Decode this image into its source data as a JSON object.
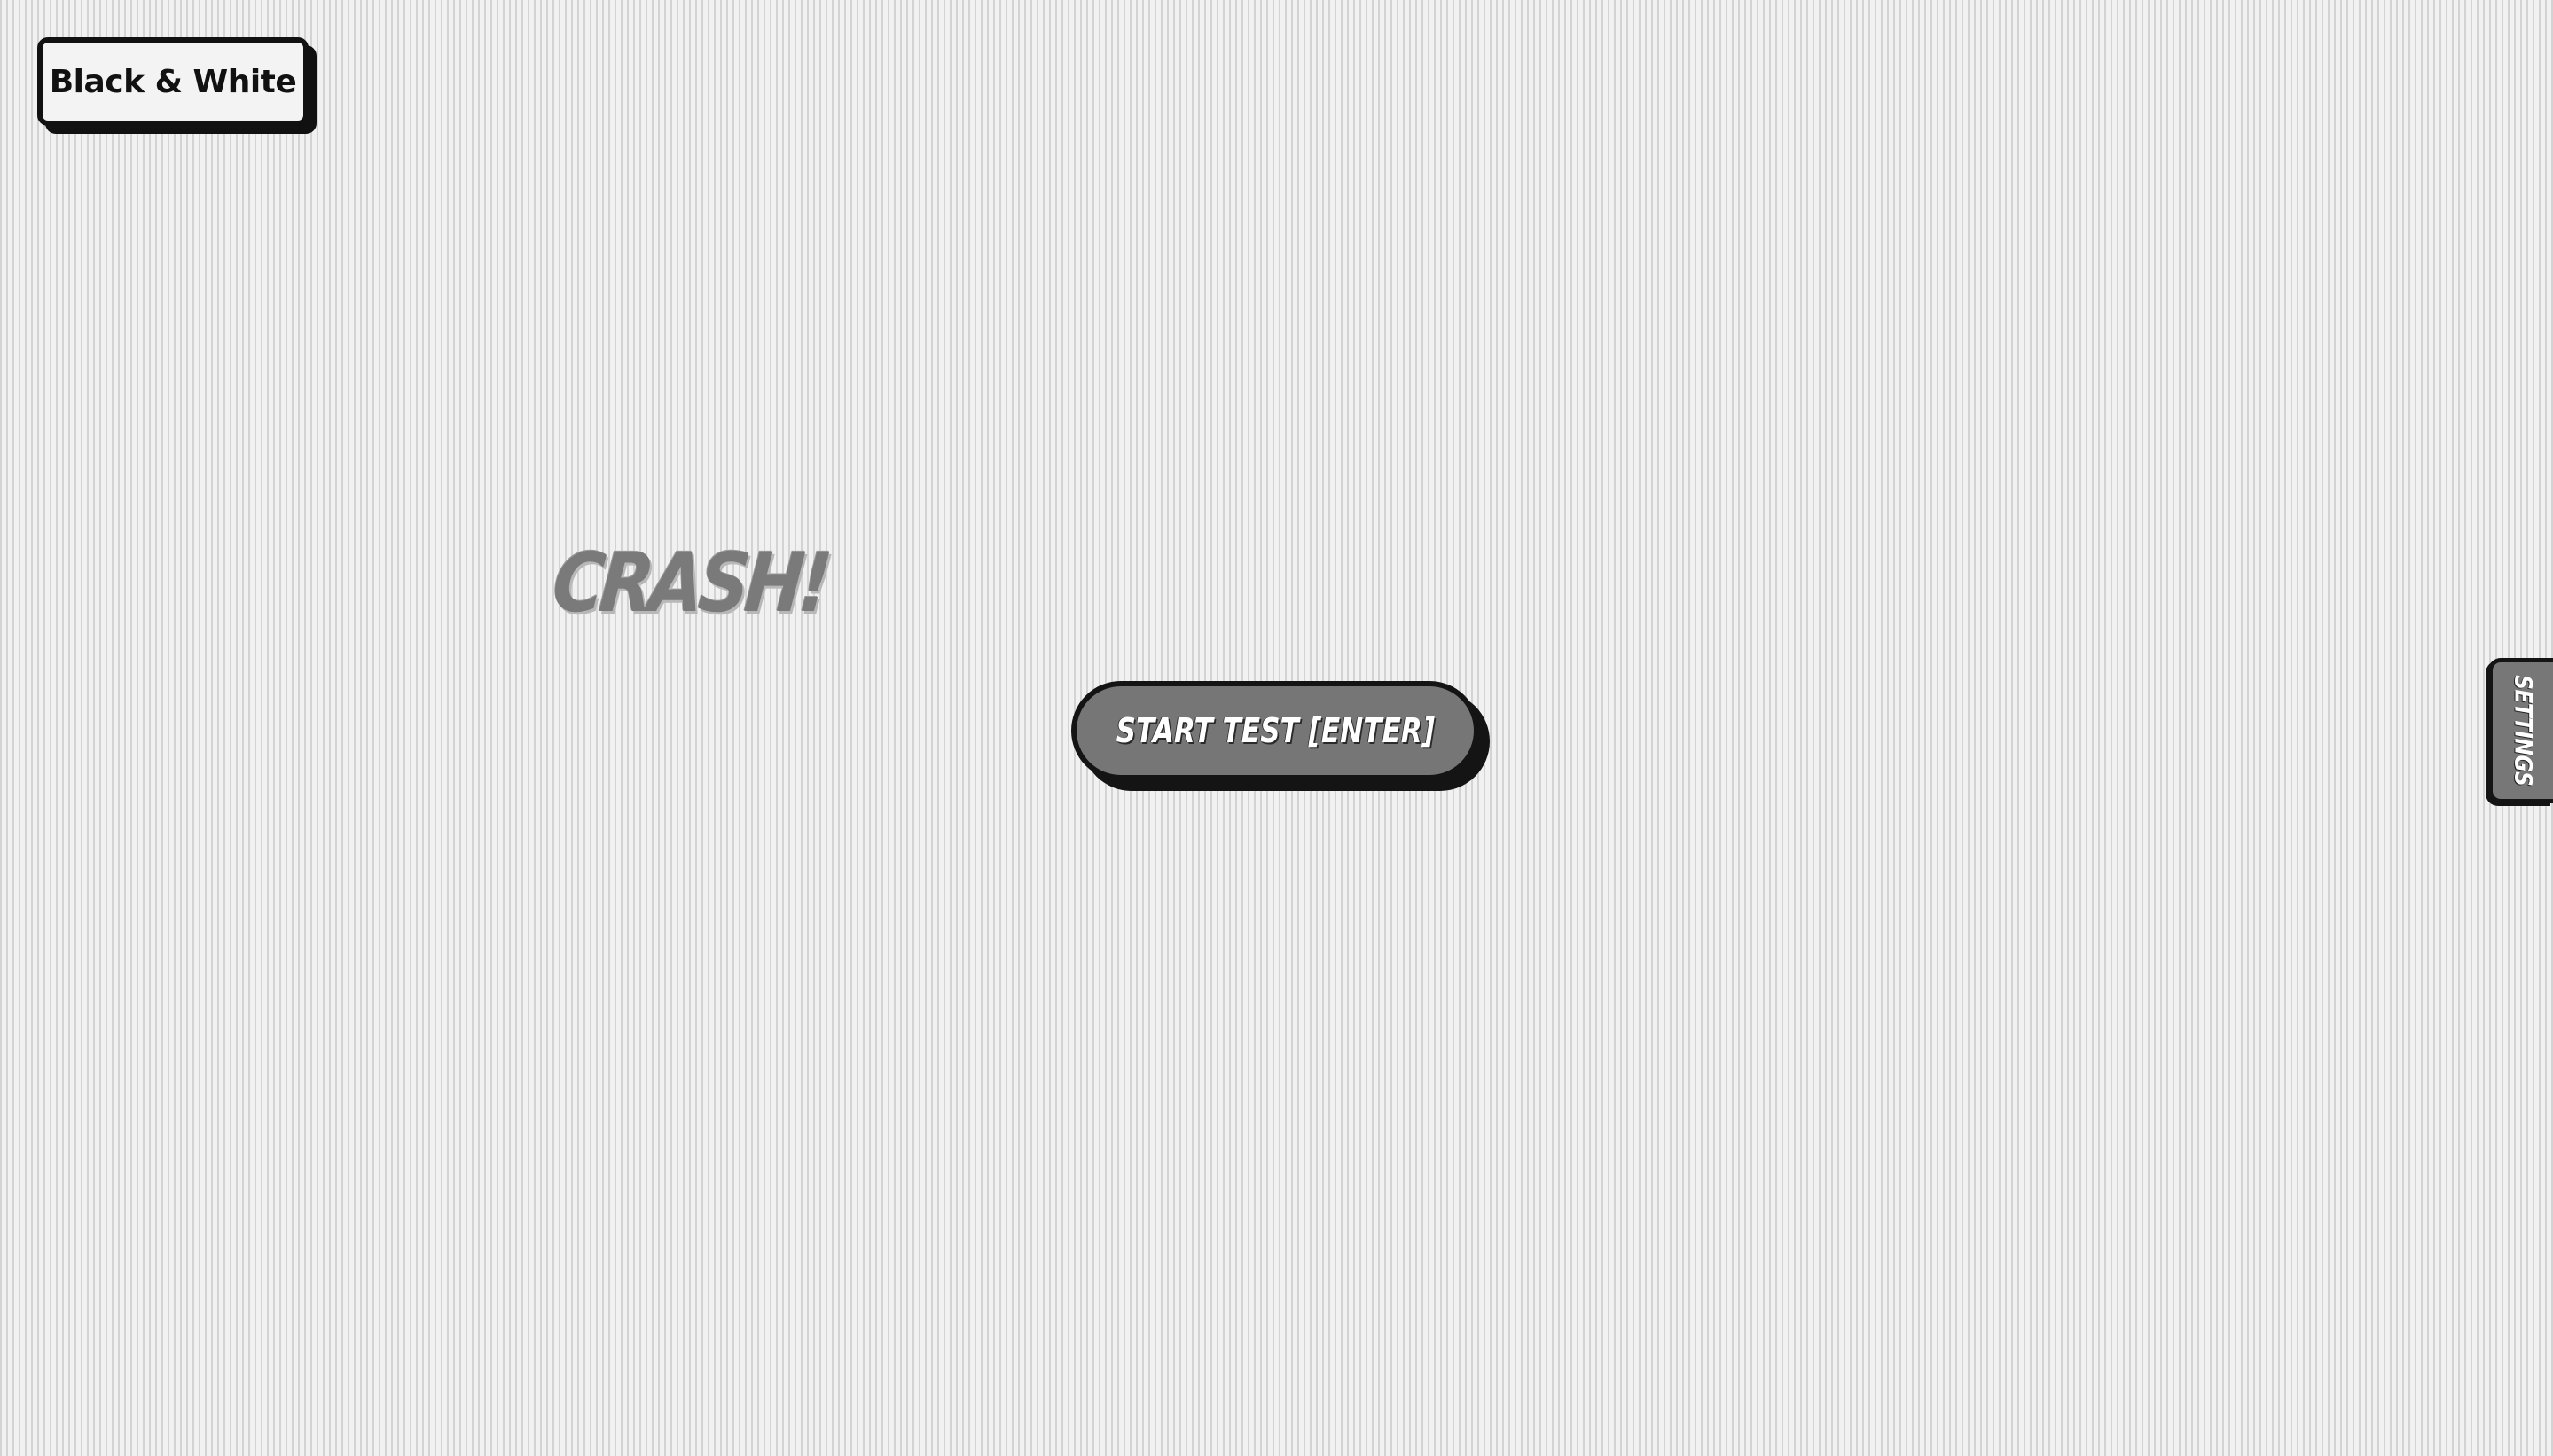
{
  "theme": {
    "label": "Black & White"
  },
  "sfx": {
    "word": "CRASH!"
  },
  "start": {
    "label": "START TEST [ENTER]"
  },
  "settings": {
    "label": "SETTINGS"
  },
  "colors": {
    "background": "#e6e6e6",
    "stripe": "#d3d3d3",
    "button_fill": "#767676",
    "outline": "#141414",
    "sfx_text": "#7a7a7a",
    "badge_fill": "#f3f3f3"
  }
}
